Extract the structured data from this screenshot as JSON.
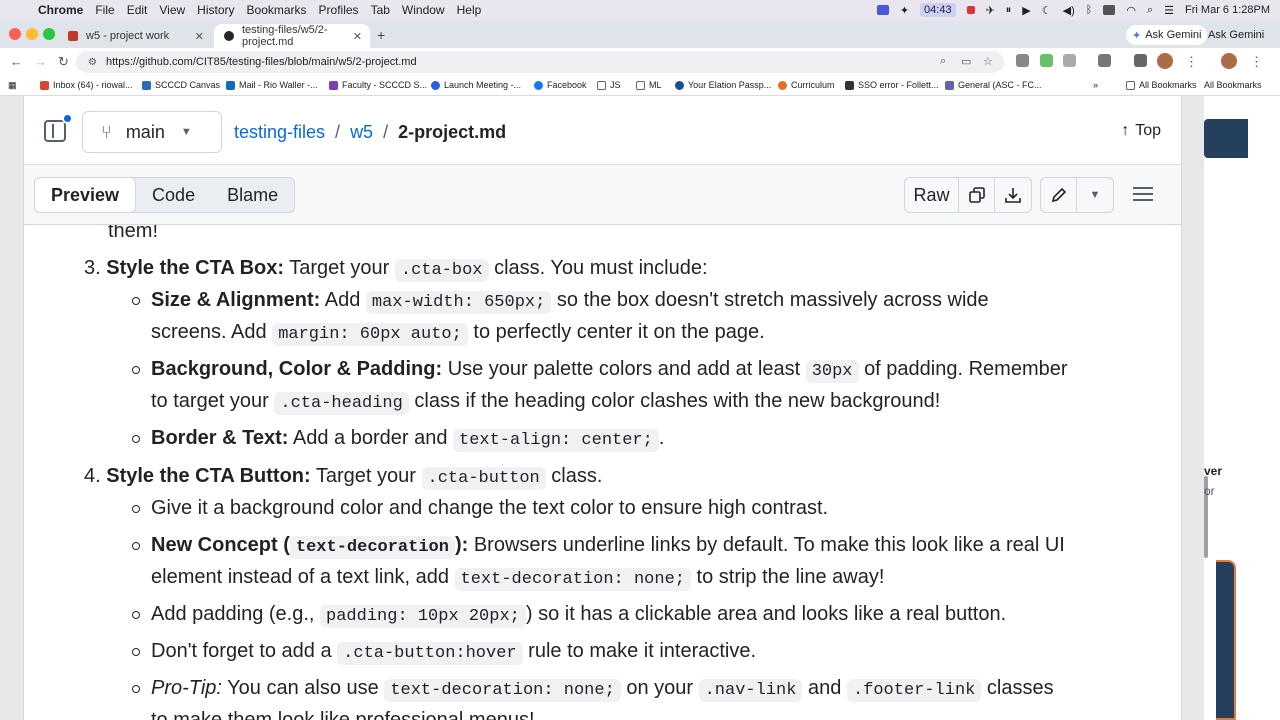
{
  "menubar": {
    "app": "Chrome",
    "items": [
      "File",
      "Edit",
      "View",
      "History",
      "Bookmarks",
      "Profiles",
      "Tab",
      "Window",
      "Help"
    ],
    "timer": "04:43",
    "clock": "Fri Mar 6  1:28PM"
  },
  "tabs": [
    {
      "title": "w5 - project work",
      "favicon_color": "#c0392b"
    },
    {
      "title": "testing-files/w5/2-project.md",
      "favicon_color": "#24292f"
    }
  ],
  "gemini": {
    "primary": "Ask Gemini",
    "secondary": "Ask Gemini"
  },
  "toolbar": {
    "url": "https://github.com/CIT85/testing-files/blob/main/w5/2-project.md"
  },
  "bookmarks": {
    "items": [
      {
        "label": "Inbox (64) - riowal...",
        "color": "#d44638"
      },
      {
        "label": "SCCCD Canvas",
        "color": "#2b6cb0"
      },
      {
        "label": "Mail - Rio Waller -...",
        "color": "#0f6cbd"
      },
      {
        "label": "Faculty - SCCCD S...",
        "color": "#7a3fb0"
      },
      {
        "label": "Launch Meeting -...",
        "color": "#2d5be3"
      },
      {
        "label": "Facebook",
        "color": "#1877f2"
      },
      {
        "label": "JS",
        "color": "#888888"
      },
      {
        "label": "ML",
        "color": "#888888"
      },
      {
        "label": "Your Elation Passp...",
        "color": "#1b4e8c"
      },
      {
        "label": "Curriculum",
        "color": "#e07020"
      },
      {
        "label": "SSO error - Follett...",
        "color": "#333333"
      },
      {
        "label": "General (ASC - FC...",
        "color": "#6264a7"
      }
    ],
    "overflow": "»",
    "all_bookmarks": "All Bookmarks",
    "all_bookmarks_2": "All Bookmarks"
  },
  "header": {
    "branch": "main",
    "repo": "testing-files",
    "folder": "w5",
    "separator": "/",
    "file": "2-project.md",
    "top": "Top"
  },
  "file_toolbar": {
    "tabs": [
      "Preview",
      "Code",
      "Blame"
    ],
    "active_tab": "Preview",
    "raw": "Raw"
  },
  "content": {
    "prev_tail": "them!",
    "item3": {
      "num": "3.",
      "title": "Style the CTA Box:",
      "t1": "Target your",
      "c1": ".cta-box",
      "t2": "class. You must include:",
      "b1": {
        "title": "Size & Alignment:",
        "t1": "Add",
        "c1": "max-width: 650px;",
        "t2": "so the box doesn't stretch massively across wide",
        "t3": "screens. Add",
        "c2": "margin: 60px auto;",
        "t4": "to perfectly center it on the page."
      },
      "b2": {
        "title": "Background, Color & Padding:",
        "t1": "Use your palette colors and add at least",
        "c1": "30px",
        "t2": "of padding. Remember",
        "t3": "to target your",
        "c2": ".cta-heading",
        "t4": "class if the heading color clashes with the new background!"
      },
      "b3": {
        "title": "Border & Text:",
        "t1": "Add a border and",
        "c1": "text-align: center;",
        "t2": "."
      }
    },
    "item4": {
      "num": "4.",
      "title": "Style the CTA Button:",
      "t1": "Target your",
      "c1": ".cta-button",
      "t2": "class.",
      "b1": {
        "text": "Give it a background color and change the text color to ensure high contrast."
      },
      "b2": {
        "title": "New Concept (",
        "code_title": "text-decoration",
        "title_end": "):",
        "t1": "Browsers underline links by default. To make this look like a real UI",
        "t2": "element instead of a text link, add",
        "c1": "text-decoration: none;",
        "t3": "to strip the line away!"
      },
      "b3": {
        "t1": "Add padding (e.g.,",
        "c1": "padding: 10px 20px;",
        "t2": ") so it has a clickable area and looks like a real button."
      },
      "b4": {
        "t1": "Don't forget to add a",
        "c1": ".cta-button:hover",
        "t2": "rule to make it interactive."
      },
      "b5": {
        "em": "Pro-Tip:",
        "t1": "You can also use",
        "c1": "text-decoration: none;",
        "t2": "on your",
        "c2": ".nav-link",
        "t3": "and",
        "c3": ".footer-link",
        "t4": "classes",
        "t5": "to make them look like professional menus!"
      }
    }
  },
  "side_window": {
    "line1": "ver",
    "line2": "or"
  }
}
